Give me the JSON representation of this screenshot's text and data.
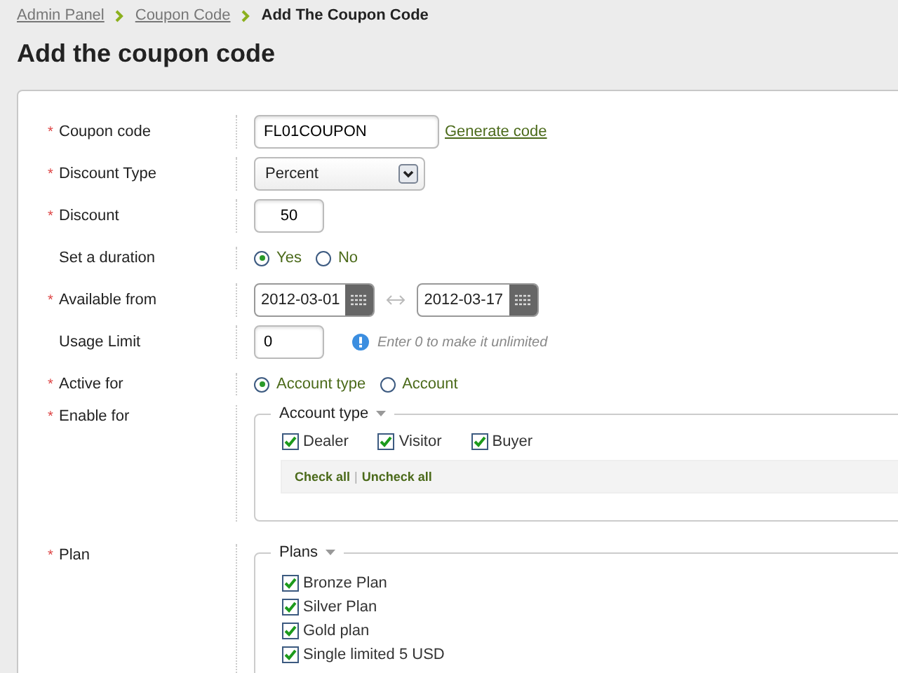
{
  "breadcrumb": [
    {
      "label": "Admin Panel",
      "kind": "link"
    },
    {
      "label": "Coupon Code",
      "kind": "link"
    },
    {
      "label": "Add The Coupon Code",
      "kind": "current"
    }
  ],
  "title": "Add the coupon code",
  "fields": [
    {
      "kind": "text",
      "label": "Coupon code",
      "required": "*",
      "value": "FL01COUPON",
      "link": "Generate code"
    },
    {
      "kind": "select",
      "label": "Discount Type",
      "required": "*",
      "value": "Percent"
    },
    {
      "kind": "number",
      "label": "Discount",
      "required": "*",
      "value": "50"
    },
    {
      "kind": "radio",
      "label": "Set a duration",
      "options": [
        {
          "label": "Yes",
          "selected": true
        },
        {
          "label": "No",
          "selected": false
        }
      ]
    },
    {
      "kind": "dates",
      "label": "Available from",
      "required": "*",
      "from": "2012-03-01",
      "to": "2012-03-17"
    },
    {
      "kind": "hint",
      "label": "Usage Limit",
      "value": "0",
      "hint": "Enter 0 to make it unlimited"
    },
    {
      "kind": "radio",
      "label": "Active for",
      "required": "*",
      "options": [
        {
          "label": "Account type",
          "selected": true
        },
        {
          "label": "Account",
          "selected": false
        }
      ]
    },
    {
      "kind": "checkgroup",
      "label": "Enable for",
      "required": "*",
      "legend": "Account type",
      "options": [
        {
          "label": "Dealer",
          "checked": true
        },
        {
          "label": "Visitor",
          "checked": true
        },
        {
          "label": "Buyer",
          "checked": true
        }
      ],
      "actions": [
        "Check all",
        "Uncheck all"
      ],
      "separator": "|"
    },
    {
      "kind": "checklist",
      "label": "Plan",
      "required": "*",
      "legend": "Plans",
      "options": [
        {
          "label": "Bronze Plan",
          "checked": true
        },
        {
          "label": "Silver Plan",
          "checked": true
        },
        {
          "label": "Gold plan",
          "checked": true
        },
        {
          "label": "Single limited 5 USD",
          "checked": true
        }
      ]
    }
  ]
}
